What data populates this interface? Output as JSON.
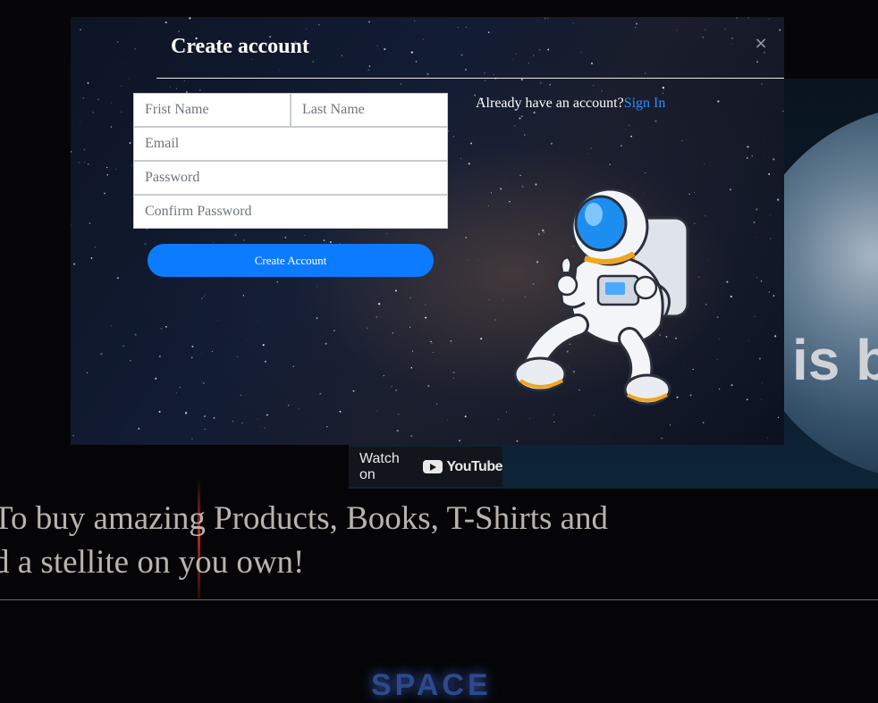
{
  "modal": {
    "title": "Create account",
    "close_glyph": "×",
    "fields": {
      "first_name_placeholder": "Frist Name",
      "last_name_placeholder": "Last Name",
      "email_placeholder": "Email",
      "password_placeholder": "Password",
      "confirm_password_placeholder": "Confirm Password"
    },
    "submit_label": "Create Account",
    "signin_prompt": "Already have an account?",
    "signin_link": "Sign In"
  },
  "video": {
    "title_fragment": "is b",
    "watch_on": "Watch on",
    "youtube_label": "YouTube"
  },
  "tagline": " To buy amazing Products, Books, T-Shirts and\nd a stellite on you own!",
  "footer": {
    "logo_text": "SPACE"
  },
  "colors": {
    "accent": "#0d7bff",
    "link": "#2c8cff",
    "modal_bg": "#121c33",
    "page_bg": "#050507"
  },
  "icons": {
    "close": "close-icon",
    "youtube": "youtube-play-icon",
    "illustration": "astronaut-icon"
  }
}
